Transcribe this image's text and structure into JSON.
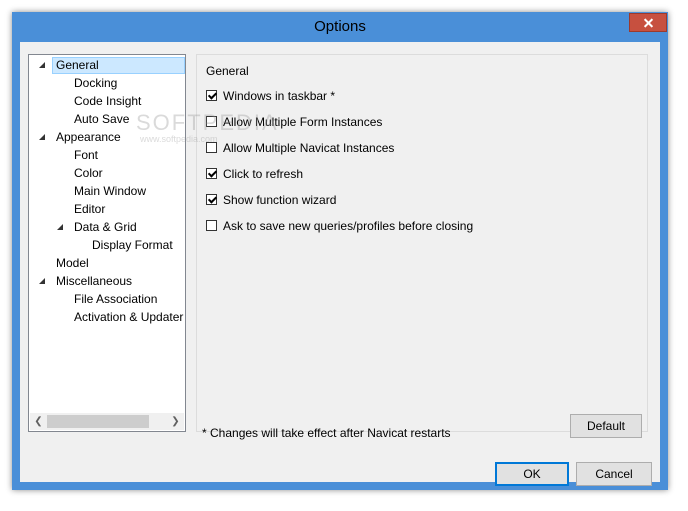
{
  "window": {
    "title": "Options"
  },
  "tree": {
    "items": [
      {
        "label": "General",
        "level": 1,
        "expanded": true,
        "selected": true
      },
      {
        "label": "Docking",
        "level": 2
      },
      {
        "label": "Code Insight",
        "level": 2
      },
      {
        "label": "Auto Save",
        "level": 2
      },
      {
        "label": "Appearance",
        "level": 1,
        "expanded": true
      },
      {
        "label": "Font",
        "level": 2
      },
      {
        "label": "Color",
        "level": 2
      },
      {
        "label": "Main Window",
        "level": 2
      },
      {
        "label": "Editor",
        "level": 2
      },
      {
        "label": "Data & Grid",
        "level": 2,
        "expanded": true
      },
      {
        "label": "Display Format",
        "level": 3
      },
      {
        "label": "Model",
        "level": 1
      },
      {
        "label": "Miscellaneous",
        "level": 1,
        "expanded": true
      },
      {
        "label": "File Association",
        "level": 2
      },
      {
        "label": "Activation & Updater",
        "level": 2
      }
    ]
  },
  "general": {
    "group_label": "General",
    "options": [
      {
        "label": "Windows in taskbar *",
        "checked": true
      },
      {
        "label": "Allow Multiple Form Instances",
        "checked": false
      },
      {
        "label": "Allow Multiple Navicat Instances",
        "checked": false
      },
      {
        "label": "Click to refresh",
        "checked": true
      },
      {
        "label": "Show function wizard",
        "checked": true
      },
      {
        "label": "Ask to save new queries/profiles before closing",
        "checked": false
      }
    ],
    "note": "* Changes will take effect after Navicat restarts",
    "default_label": "Default"
  },
  "footer": {
    "ok_label": "OK",
    "cancel_label": "Cancel"
  },
  "watermark": {
    "text": "SOFTPEDIA",
    "small": "www.softpedia.com"
  },
  "colors": {
    "frame": "#4a8fd8",
    "selection": "#cce8ff",
    "close": "#c7503f"
  }
}
